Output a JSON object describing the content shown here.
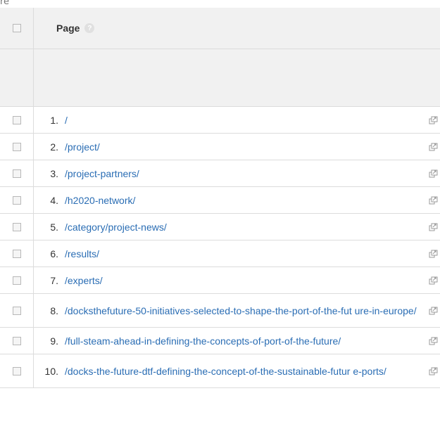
{
  "cropped_label": "re",
  "header": {
    "page_label": "Page",
    "help_glyph": "?"
  },
  "rows": [
    {
      "num": "1.",
      "path": "/"
    },
    {
      "num": "2.",
      "path": "/project/"
    },
    {
      "num": "3.",
      "path": "/project-partners/"
    },
    {
      "num": "4.",
      "path": "/h2020-network/"
    },
    {
      "num": "5.",
      "path": "/category/project-news/"
    },
    {
      "num": "6.",
      "path": "/results/"
    },
    {
      "num": "7.",
      "path": "/experts/"
    },
    {
      "num": "8.",
      "path": "/docksthefuture-50-initiatives-selected-to-shape-the-port-of-the-fut ure-in-europe/"
    },
    {
      "num": "9.",
      "path": "/full-steam-ahead-in-defining-the-concepts-of-port-of-the-future/"
    },
    {
      "num": "10.",
      "path": "/docks-the-future-dtf-defining-the-concept-of-the-sustainable-futur e-ports/"
    }
  ],
  "icons": {
    "external_link": "open-in-new-window-icon",
    "checkbox": "checkbox-unchecked",
    "help": "help-icon"
  },
  "colors": {
    "link": "#2a6db4",
    "header_bg": "#f1f1f1",
    "border": "#dcdcdc"
  }
}
